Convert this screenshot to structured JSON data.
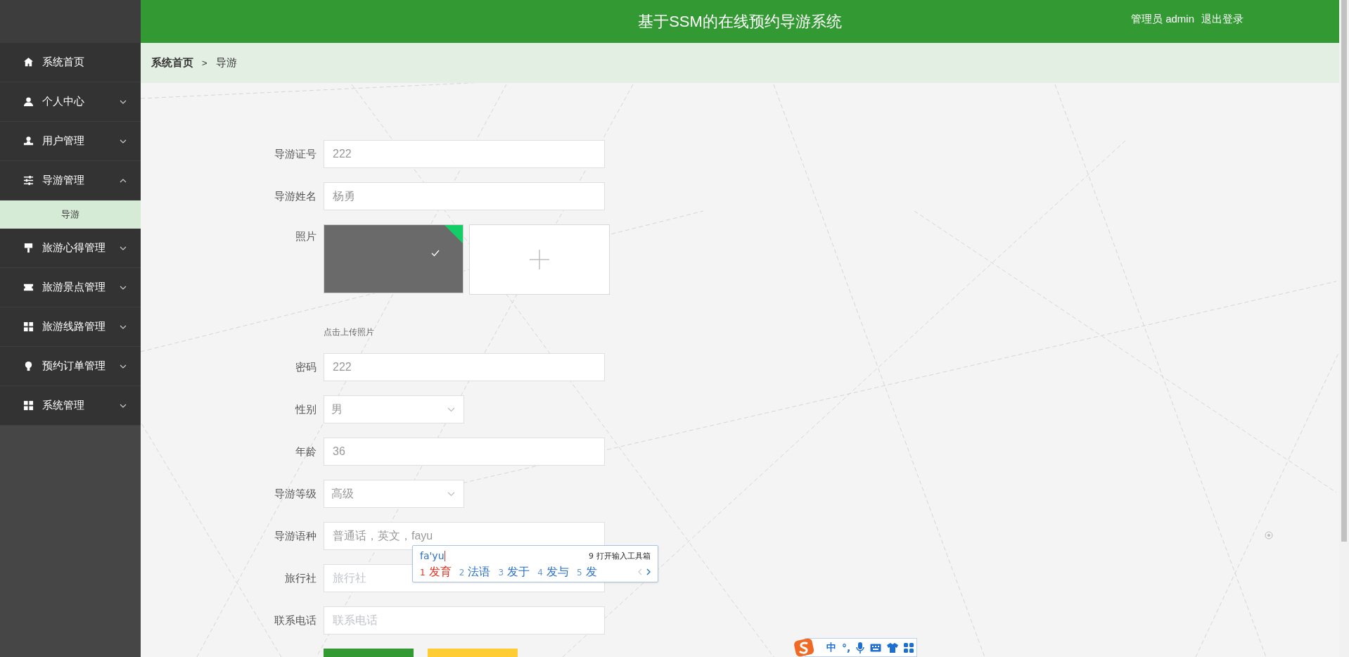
{
  "header": {
    "title": "基于SSM的在线预约导游系统",
    "user_label": "管理员 admin",
    "logout": "退出登录"
  },
  "sidebar": {
    "items": [
      {
        "label": "系统首页",
        "kind": "link"
      },
      {
        "label": "个人中心",
        "kind": "menu",
        "expanded": false
      },
      {
        "label": "用户管理",
        "kind": "menu",
        "expanded": false
      },
      {
        "label": "导游管理",
        "kind": "menu",
        "expanded": true,
        "children": [
          {
            "label": "导游",
            "selected": true
          }
        ]
      },
      {
        "label": "旅游心得管理",
        "kind": "menu",
        "expanded": false
      },
      {
        "label": "旅游景点管理",
        "kind": "menu",
        "expanded": false
      },
      {
        "label": "旅游线路管理",
        "kind": "menu",
        "expanded": false
      },
      {
        "label": "预约订单管理",
        "kind": "menu",
        "expanded": false
      },
      {
        "label": "系统管理",
        "kind": "menu",
        "expanded": false
      }
    ]
  },
  "breadcrumb": {
    "items": [
      "系统首页",
      "导游"
    ],
    "separator": ">"
  },
  "form": {
    "fields": [
      {
        "label": "导游证号",
        "kind": "input",
        "value": "222"
      },
      {
        "label": "导游姓名",
        "kind": "input",
        "value": "杨勇"
      },
      {
        "label": "照片",
        "kind": "upload",
        "uploaded": true,
        "hint": "点击上传照片"
      },
      {
        "label": "密码",
        "kind": "input",
        "value": "222"
      },
      {
        "label": "性别",
        "kind": "select",
        "value": "男"
      },
      {
        "label": "年龄",
        "kind": "input",
        "value": "36"
      },
      {
        "label": "导游等级",
        "kind": "select",
        "value": "高级"
      },
      {
        "label": "导游语种",
        "kind": "input",
        "value": "普通话，英文，fayu"
      },
      {
        "label": "旅行社",
        "kind": "input",
        "placeholder": "旅行社"
      },
      {
        "label": "联系电话",
        "kind": "input",
        "placeholder": "联系电话"
      }
    ],
    "buttons": [
      {
        "color": "#339933"
      },
      {
        "color": "#ffcc33"
      }
    ]
  },
  "ime": {
    "composition": "fa'yu",
    "toolbox_key": "9",
    "toolbox": "打开输入工具箱",
    "candidates": [
      {
        "index": "1",
        "text": "发育",
        "selected": true
      },
      {
        "index": "2",
        "text": "法语",
        "selected": false
      },
      {
        "index": "3",
        "text": "发于",
        "selected": false
      },
      {
        "index": "4",
        "text": "发与",
        "selected": false
      },
      {
        "index": "5",
        "text": "发",
        "selected": false
      }
    ]
  },
  "ime_toolbar": {
    "mode": "中",
    "punctuation": "°,"
  }
}
